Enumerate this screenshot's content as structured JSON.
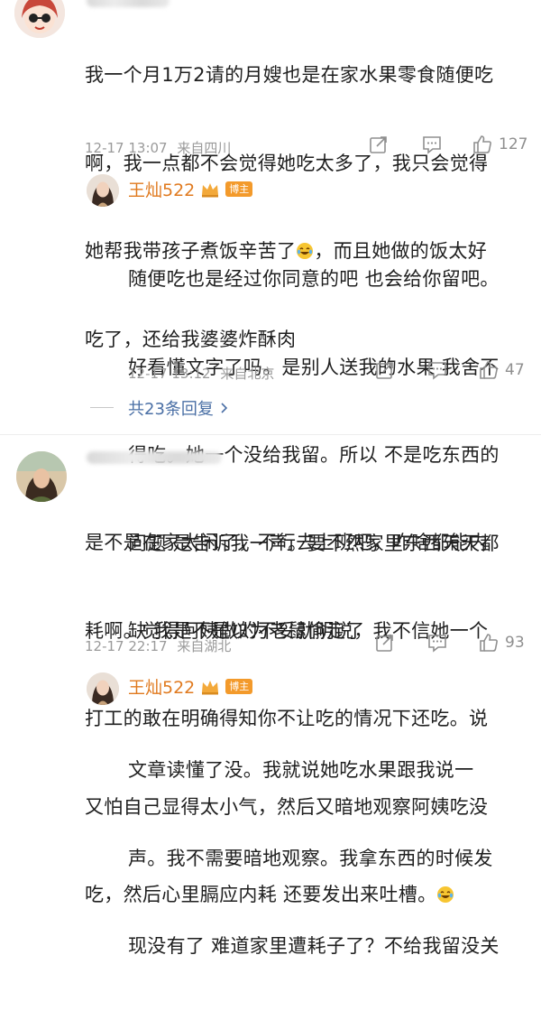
{
  "comments": [
    {
      "text_line1": "我一个月1万2请的月嫂也是在家水果零食随便吃",
      "text_line2": "啊，我一点都不会觉得她吃太多了，我只会觉得",
      "text_line3a": "她帮我带孩子煮饭辛苦了",
      "text_line3b": "，而且她做的饭太好",
      "text_line4": "吃了，还给我婆婆炸酥肉",
      "time": "12-17 13:07",
      "location": "来自四川",
      "likes": "127",
      "avatar_icon": "cartoon-girl-avatar-icon"
    },
    {
      "name": "王灿522",
      "badge": "博主",
      "text_lines": [
        "随便吃也是经过你同意的吧 也会给你留吧。",
        "好看懂文字了吗。是别人送我的水果 我舍不",
        "得吃。她一个没给我留。所以 不是吃东西的",
        "问题 是告诉我一声。要不然家里东西天天都",
        "缺 我是不是以为老鼠偷走了"
      ],
      "time": "12-17 13:12",
      "location": "来自北京",
      "likes": "47",
      "more_replies": "共23条回复"
    },
    {
      "text_lines": [
        "是不是在家太闲了，不行去上班吧，咋啥都能内",
        "耗啊。觉得阿姨做的不妥就明说，我不信她一个",
        "打工的敢在明确得知你不让吃的情况下还吃。说",
        "又怕自己显得太小气，然后又暗地观察阿姨吃没",
        "吃，然后心里膈应内耗 还要发出来吐槽。"
      ],
      "time": "12-17 22:17",
      "location": "来自湖北",
      "likes": "93"
    },
    {
      "name": "王灿522",
      "badge": "博主",
      "text_lines": [
        "文章读懂了没。我就说她吃水果跟我说一",
        "声。我不需要暗地观察。我拿东西的时候发",
        "现没有了 难道家里遭耗子了？不给我留没关"
      ]
    }
  ],
  "colors": {
    "name": "#e07a1f",
    "badge_bg": "#f39a2b",
    "link": "#4a6fa5",
    "meta": "#9a9a9a"
  }
}
